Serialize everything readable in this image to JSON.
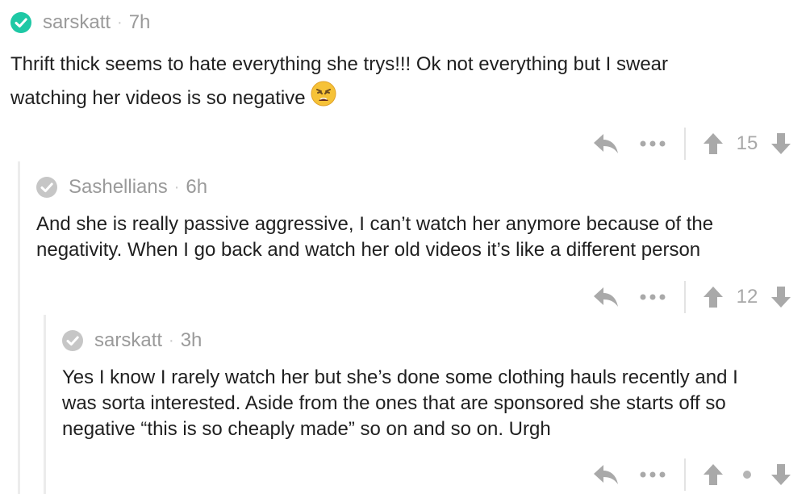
{
  "comments": [
    {
      "author": "sarskatt",
      "time": "7h",
      "verified_color": "#1ec8a5",
      "lines": [
        "Thrift thick seems to hate everything she trys!!! Ok not everything but I swear",
        "watching her videos is so negative"
      ],
      "emoji": "weary-face-icon",
      "score": "15"
    },
    {
      "author": "Sashellians",
      "time": "6h",
      "verified_color": "#c6c6c6",
      "lines": [
        "And she is really passive aggressive, I can’t watch her anymore because of the",
        "negativity. When I go back and watch her old videos it’s like a different person"
      ],
      "score": "12"
    },
    {
      "author": "sarskatt",
      "time": "3h",
      "verified_color": "#c6c6c6",
      "lines": [
        "Yes I know I rarely watch her but she’s done some clothing hauls recently and I",
        "was sorta interested. Aside from the ones that are sponsored she starts off so",
        "negative “this is so cheaply made” so on and so on. Urgh"
      ],
      "score": ""
    }
  ],
  "separator": "·",
  "icons": {
    "reply": "reply-arrow-icon",
    "more": "more-dots-icon",
    "upvote": "upvote-arrow-icon",
    "downvote": "downvote-arrow-icon"
  }
}
